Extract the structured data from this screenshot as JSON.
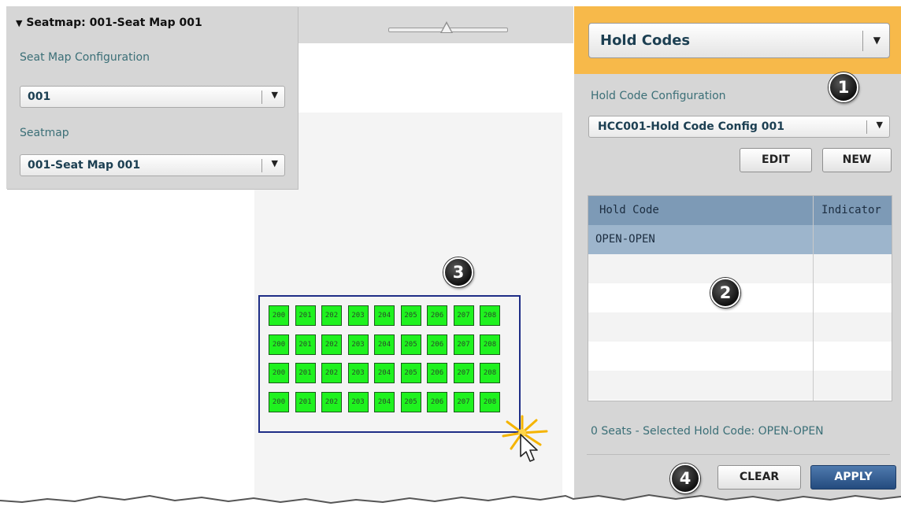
{
  "config_panel": {
    "title": "Seatmap: 001-Seat Map 001",
    "seat_map_configuration_label": "Seat Map Configuration",
    "seat_map_configuration_value": "001",
    "seatmap_label": "Seatmap",
    "seatmap_value": "001-Seat Map 001"
  },
  "zoom_slider": {
    "level": 0.5
  },
  "seatmap": {
    "rows": [
      [
        "200",
        "201",
        "202",
        "203",
        "204",
        "205",
        "206",
        "207",
        "208"
      ],
      [
        "200",
        "201",
        "202",
        "203",
        "204",
        "205",
        "206",
        "207",
        "208"
      ],
      [
        "200",
        "201",
        "202",
        "203",
        "204",
        "205",
        "206",
        "207",
        "208"
      ],
      [
        "200",
        "201",
        "202",
        "203",
        "204",
        "205",
        "206",
        "207",
        "208"
      ]
    ],
    "seat_color": "#1ff21f",
    "selection_border_color": "#1e2d86"
  },
  "hold_panel": {
    "mode_value": "Hold Codes",
    "config_label": "Hold Code Configuration",
    "config_value": "HCC001-Hold Code Config 001",
    "edit_label": "EDIT",
    "new_label": "NEW",
    "table": {
      "columns": [
        "Hold Code",
        "Indicator"
      ],
      "rows": [
        {
          "hold_code": "OPEN-OPEN",
          "indicator": "",
          "selected": true
        }
      ]
    },
    "status_text": "0 Seats - Selected Hold Code: OPEN-OPEN",
    "clear_label": "CLEAR",
    "apply_label": "APPLY",
    "header_color": "#f7b94a"
  },
  "callouts": [
    "1",
    "2",
    "3",
    "4"
  ],
  "icons": {
    "collapse": "triangle-down-icon",
    "dropdown": "chevron-down-icon",
    "cursor": "arrow-cursor-icon",
    "click": "click-burst-icon"
  }
}
